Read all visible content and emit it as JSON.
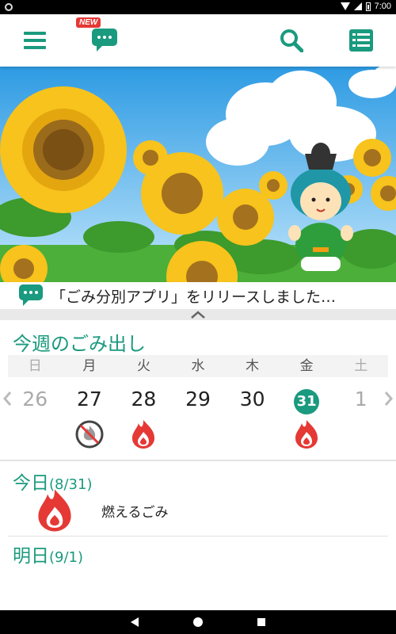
{
  "status_bar": {
    "time": "7:00"
  },
  "toolbar": {
    "new_badge": "NEW"
  },
  "news": {
    "text": "「ごみ分別アプリ」をリリースしました…"
  },
  "week": {
    "title": "今週のごみ出し",
    "weekdays": [
      "日",
      "月",
      "火",
      "水",
      "木",
      "金",
      "土"
    ],
    "dates": [
      "26",
      "27",
      "28",
      "29",
      "30",
      "31",
      "1"
    ],
    "icons": [
      "",
      "no-burn-icon",
      "burnable-fire-icon",
      "",
      "",
      "burnable-fire-icon",
      ""
    ]
  },
  "today": {
    "label": "今日",
    "date": "(8/31)",
    "item": "燃えるごみ"
  },
  "tomorrow": {
    "label": "明日",
    "date": "(9/1)"
  },
  "colors": {
    "accent": "#1a9a7e",
    "fire": "#e53935"
  }
}
